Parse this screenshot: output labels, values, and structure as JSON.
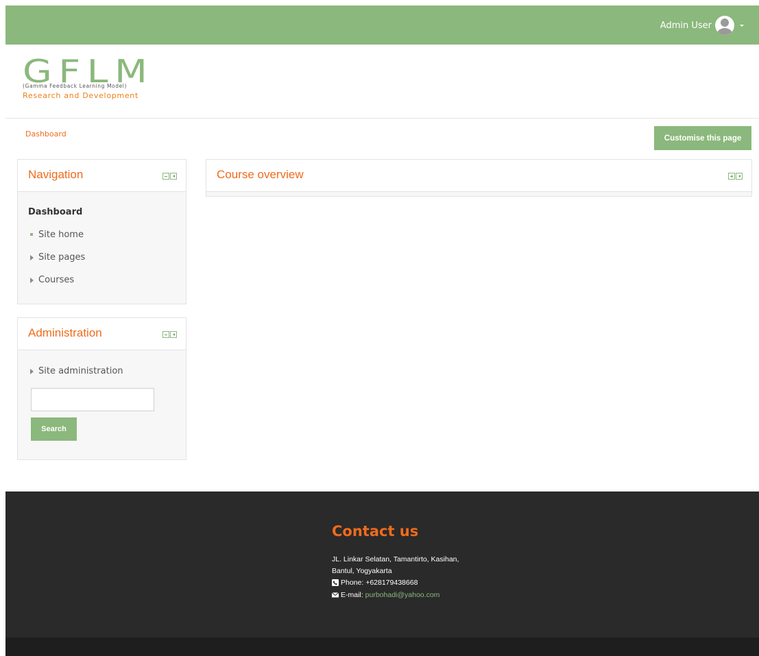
{
  "colors": {
    "brand_green": "#8bb87c",
    "accent_orange": "#ef6b1c",
    "footer_bg": "#2a2a2a"
  },
  "header": {
    "user_name": "Admin User",
    "avatar_icon": "user-avatar-icon",
    "menu_icon": "caret-down-icon"
  },
  "logo": {
    "letters": "GFLM",
    "tagline": "(Gamma Feedback Learning Model)",
    "subtitle": "Research and Development"
  },
  "breadcrumb": {
    "label": "Dashboard"
  },
  "page_actions": {
    "customise_label": "Customise this page"
  },
  "navigation_block": {
    "title": "Navigation",
    "dashboard_label": "Dashboard",
    "items": [
      {
        "label": "Site home",
        "icon": "square-bullet-icon"
      },
      {
        "label": "Site pages",
        "icon": "expand-triangle-icon"
      },
      {
        "label": "Courses",
        "icon": "expand-triangle-icon"
      }
    ]
  },
  "administration_block": {
    "title": "Administration",
    "items": [
      {
        "label": "Site administration",
        "icon": "expand-triangle-icon"
      }
    ],
    "search_value": "",
    "search_button": "Search"
  },
  "course_overview_block": {
    "title": "Course overview"
  },
  "footer": {
    "contact_title": "Contact us",
    "address_line1": "JL. Linkar Selatan, Tamantirto, Kasihan,",
    "address_line2": "Bantul, Yogyakarta",
    "phone_label": "Phone: +628179438668",
    "email_label": "E-mail:",
    "email_value": "purbohadi@yahoo.com"
  }
}
